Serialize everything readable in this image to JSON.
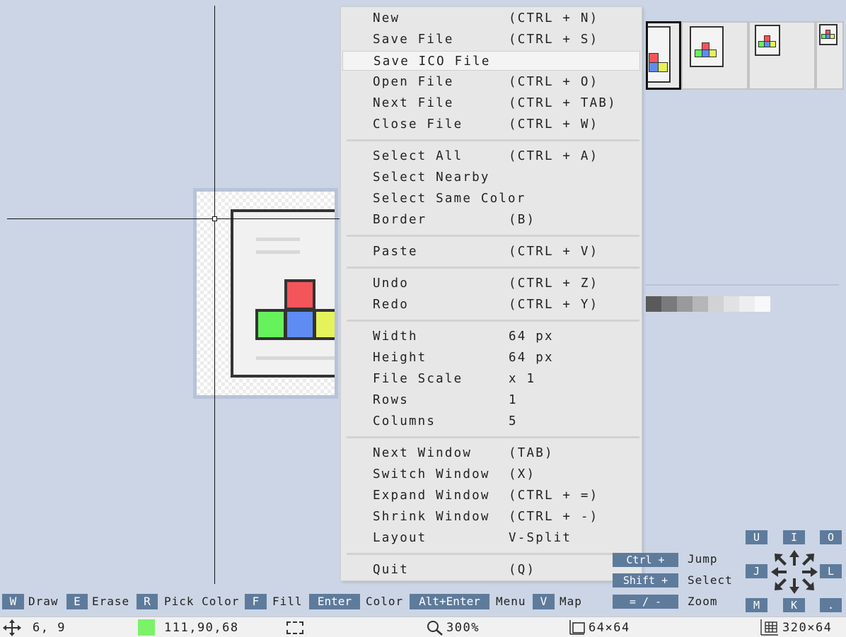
{
  "menu": {
    "groups": [
      {
        "items": [
          {
            "label": "New",
            "shortcut": "(CTRL + N)"
          },
          {
            "label": "Save File",
            "shortcut": "(CTRL + S)"
          },
          {
            "label": "Save ICO File",
            "shortcut": ""
          },
          {
            "label": "Open File",
            "shortcut": "(CTRL + O)"
          },
          {
            "label": "Next File",
            "shortcut": "(CTRL + TAB)"
          },
          {
            "label": "Close File",
            "shortcut": "(CTRL + W)"
          }
        ]
      },
      {
        "items": [
          {
            "label": "Select All",
            "shortcut": "(CTRL + A)"
          },
          {
            "label": "Select Nearby",
            "shortcut": ""
          },
          {
            "label": "Select Same Color",
            "shortcut": ""
          },
          {
            "label": "Border",
            "shortcut": "(B)"
          }
        ]
      },
      {
        "items": [
          {
            "label": "Paste",
            "shortcut": "(CTRL + V)"
          }
        ]
      },
      {
        "items": [
          {
            "label": "Undo",
            "shortcut": "(CTRL + Z)"
          },
          {
            "label": "Redo",
            "shortcut": "(CTRL + Y)"
          }
        ]
      },
      {
        "items": [
          {
            "label": "Width",
            "shortcut": "64 px"
          },
          {
            "label": "Height",
            "shortcut": "64 px"
          },
          {
            "label": "File Scale",
            "shortcut": "x 1"
          },
          {
            "label": "Rows",
            "shortcut": "1"
          },
          {
            "label": "Columns",
            "shortcut": "5"
          }
        ]
      },
      {
        "items": [
          {
            "label": "Next Window",
            "shortcut": "(TAB)"
          },
          {
            "label": "Switch Window",
            "shortcut": "(X)"
          },
          {
            "label": "Expand Window",
            "shortcut": "(CTRL + =)"
          },
          {
            "label": "Shrink Window",
            "shortcut": "(CTRL + -)"
          },
          {
            "label": "Layout",
            "shortcut": "V-Split"
          }
        ]
      },
      {
        "items": [
          {
            "label": "Quit",
            "shortcut": "(Q)"
          }
        ]
      }
    ],
    "hovered_index": 2
  },
  "hints": [
    {
      "key": "W",
      "label": "Draw"
    },
    {
      "key": "E",
      "label": "Erase"
    },
    {
      "key": "R",
      "label": "Pick Color"
    },
    {
      "key": "F",
      "label": "Fill"
    },
    {
      "key": "Enter",
      "label": "Color"
    },
    {
      "key": "Alt+Enter",
      "label": "Menu"
    },
    {
      "key": "V",
      "label": "Map"
    }
  ],
  "pad": {
    "keys": {
      "u": "U",
      "i": "I",
      "o": "O",
      "j": "J",
      "l": "L",
      "m": "M",
      "k": "K",
      "dot": "."
    },
    "rows": [
      {
        "key": "Ctrl +",
        "label": "Jump"
      },
      {
        "key": "Shift +",
        "label": "Select"
      },
      {
        "key": "= / -",
        "label": "Zoom"
      }
    ]
  },
  "status": {
    "cursor_pos": "6, 9",
    "color_value": "111,90,68",
    "zoom": "300%",
    "image_size": "64×64",
    "sheet_size": "320×64"
  },
  "colors": {
    "background": "#cbd5e5",
    "key_bg": "#5e7b9c",
    "current_color": "#7bf267",
    "pixel_red": "#f4555a",
    "pixel_green": "#66f25a",
    "pixel_blue": "#5e8cf2",
    "pixel_yellow": "#e6f25a"
  },
  "swatches": [
    "#5a5a5a",
    "#7a7a7a",
    "#9a9a9a",
    "#b6b6b6",
    "#d2d2d2",
    "#e2e2e2",
    "#eeeeee",
    "#f8f8f8"
  ],
  "icons": {
    "move": "move-arrows-icon",
    "selection": "selection-rect-icon",
    "zoom": "magnifier-icon",
    "image_size": "image-size-icon",
    "sheet_size": "sheet-grid-icon",
    "pan_arrows": "eight-way-arrows-icon"
  }
}
